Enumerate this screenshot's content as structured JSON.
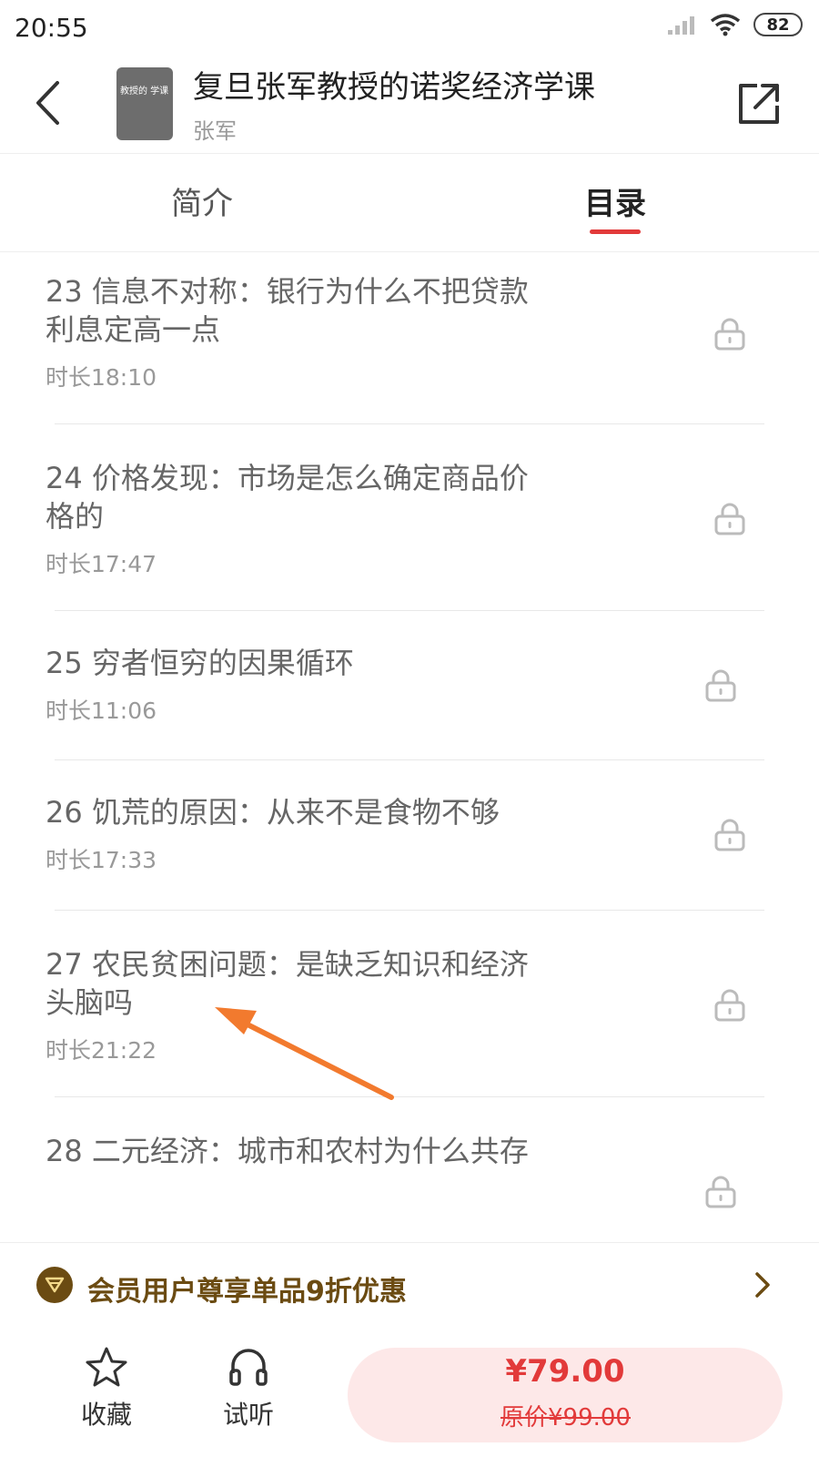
{
  "status": {
    "time": "20:55",
    "battery": "82"
  },
  "header": {
    "title": "复旦张军教授的诺奖经济学课",
    "author": "张军",
    "cover_text": "教授的 学课"
  },
  "tabs": [
    {
      "label": "简介"
    },
    {
      "label": "目录"
    }
  ],
  "episodes": [
    {
      "title": "23 信息不对称：银行为什么不把贷款利息定高一点",
      "duration": "时长18:10",
      "locked": true
    },
    {
      "title": "24 价格发现：市场是怎么确定商品价格的",
      "duration": "时长17:47",
      "locked": true
    },
    {
      "title": "25 穷者恒穷的因果循环",
      "duration": "时长11:06",
      "locked": true
    },
    {
      "title": "26 饥荒的原因：从来不是食物不够",
      "duration": "时长17:33",
      "locked": true
    },
    {
      "title": "27 农民贫困问题：是缺乏知识和经济头脑吗",
      "duration": "时长21:22",
      "locked": true
    },
    {
      "title": "28 二元经济：城市和农村为什么共存",
      "duration": "",
      "locked": true
    }
  ],
  "member_bar": {
    "text": "会员用户尊享单品9折优惠"
  },
  "bottom": {
    "favorite_label": "收藏",
    "listen_label": "试听",
    "price": "¥79.00",
    "original_price": "原价¥99.00"
  },
  "colors": {
    "accent": "#e23a3a",
    "member": "#6b4b12",
    "annotation_arrow": "#f27a2e"
  },
  "icons": [
    "back-icon",
    "share-icon",
    "lock-icon",
    "member-badge-icon",
    "chevron-right-icon",
    "star-icon",
    "headphones-icon"
  ]
}
